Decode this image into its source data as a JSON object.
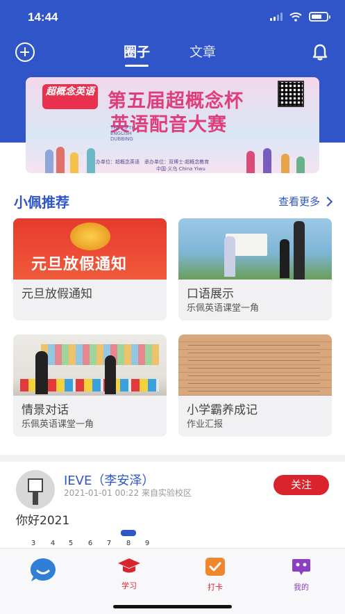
{
  "status": {
    "time": "14:44"
  },
  "nav": {
    "tabs": [
      "圈子",
      "文章"
    ]
  },
  "banner": {
    "logo": "超概念英语",
    "title_line1": "第五届超概念杯",
    "title_line2": "英语配音大赛",
    "subtitle": "THE FIFTH ENGLISH DUBBING",
    "organizer": "主办单位：超概念英语　承办单位：双博士·超概念教育",
    "location": "中国·义乌 China Yiwu"
  },
  "recommend": {
    "title": "小佩推荐",
    "more": "查看更多",
    "cards": [
      {
        "title": "元旦放假通知",
        "subtitle": "",
        "image_text": "元旦放假通知"
      },
      {
        "title": "口语展示",
        "subtitle": "乐佩英语课堂一角"
      },
      {
        "title": "情景对话",
        "subtitle": "乐佩英语课堂一角"
      },
      {
        "title": "小学霸养成记",
        "subtitle": "作业汇报"
      }
    ]
  },
  "post": {
    "name": "IEVE（李安泽）",
    "meta": "2021-01-01 00:22 来自实验校区",
    "follow": "关注",
    "text": "你好2021",
    "calendar_days": [
      "3",
      "4",
      "5",
      "6",
      "7",
      "8",
      "9"
    ]
  },
  "tabbar": {
    "items": [
      {
        "label": "",
        "icon": "chat-bubble-icon",
        "color": "#2f7fd6"
      },
      {
        "label": "学习",
        "icon": "graduation-cap-icon",
        "color": "#d9232d"
      },
      {
        "label": "打卡",
        "icon": "checkin-icon",
        "color": "#d9232d"
      },
      {
        "label": "我的",
        "icon": "profile-icon",
        "color": "#8a3fc4"
      }
    ]
  }
}
